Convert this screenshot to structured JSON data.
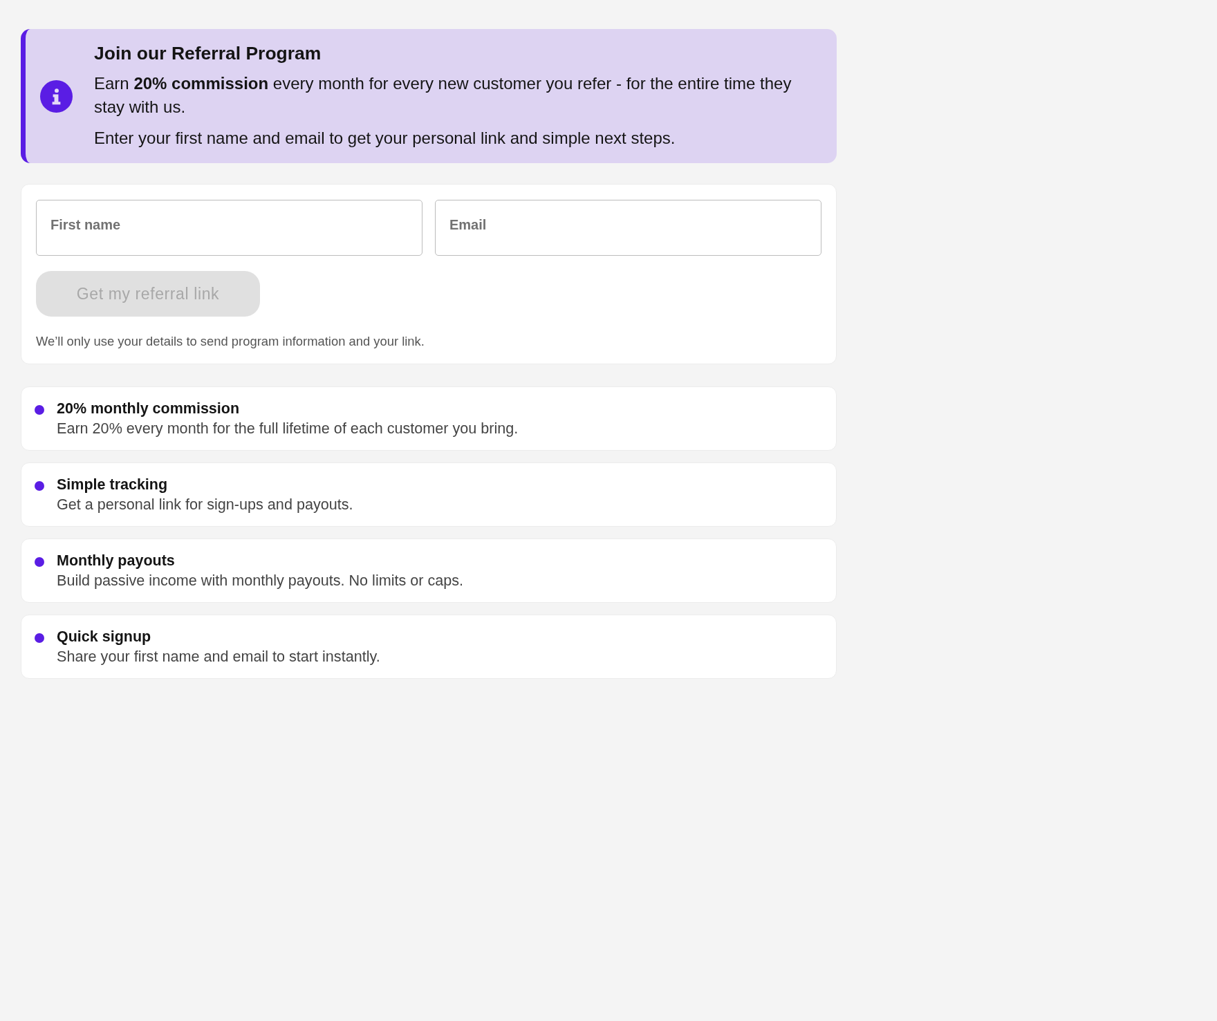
{
  "banner": {
    "title": "Join our Referral Program",
    "paragraphs": [
      "Earn **20% commission** every month for every new customer you refer - for the entire time they stay with us.",
      "Enter your first name and email to get your personal link and simple next steps."
    ]
  },
  "form": {
    "fields": [
      {
        "placeholder": "First name"
      },
      {
        "placeholder": "Email"
      }
    ],
    "submit": {
      "label": "Get my referral link",
      "disabled": true
    },
    "note": "We’ll only use your details to send program information and your link."
  },
  "features": [
    {
      "title": "20% monthly commission",
      "description": "Earn 20% every month for the full lifetime of each customer you bring."
    },
    {
      "title": "Simple tracking",
      "description": "Get a personal link for sign-ups and payouts."
    },
    {
      "title": "Monthly payouts",
      "description": "Build passive income with monthly payouts. No limits or caps."
    },
    {
      "title": "Quick signup",
      "description": "Share your first name and email to start instantly."
    }
  ]
}
